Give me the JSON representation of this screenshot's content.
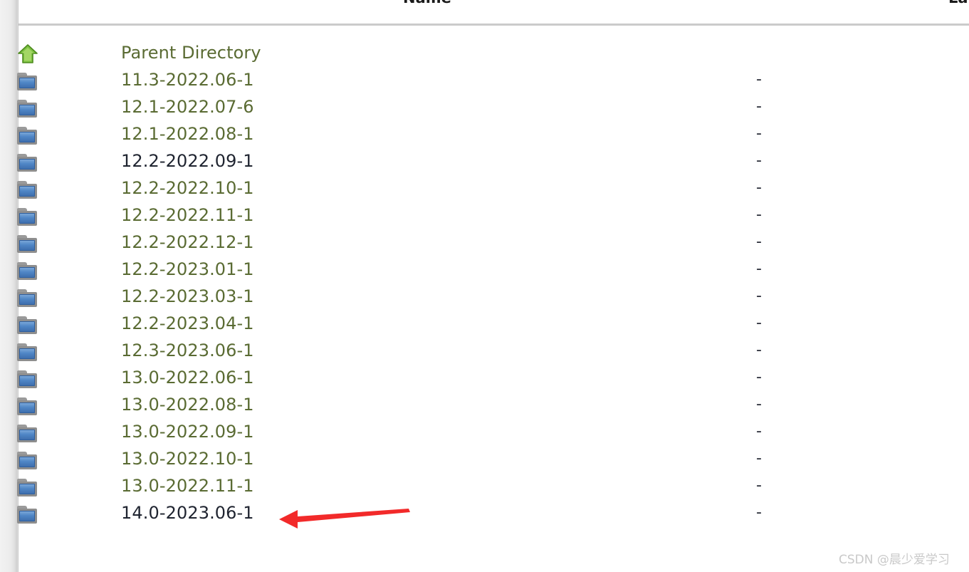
{
  "page": {
    "background_color": "#ffffff",
    "visited_link_color": "#5a6b33",
    "unvisited_link_color": "#1f2430",
    "rule_color": "#cbcbcb",
    "annotation_arrow_color": "#f22a2a"
  },
  "headers": {
    "name": "Name",
    "last_modified": "La"
  },
  "listing": {
    "rows": [
      {
        "icon": "up-arrow-icon",
        "name": "Parent Directory",
        "size": "",
        "visited": true
      },
      {
        "icon": "folder-icon",
        "name": "11.3-2022.06-1",
        "size": "-",
        "visited": true
      },
      {
        "icon": "folder-icon",
        "name": "12.1-2022.07-6",
        "size": "-",
        "visited": true
      },
      {
        "icon": "folder-icon",
        "name": "12.1-2022.08-1",
        "size": "-",
        "visited": true
      },
      {
        "icon": "folder-icon",
        "name": "12.2-2022.09-1",
        "size": "-",
        "visited": false
      },
      {
        "icon": "folder-icon",
        "name": "12.2-2022.10-1",
        "size": "-",
        "visited": true
      },
      {
        "icon": "folder-icon",
        "name": "12.2-2022.11-1",
        "size": "-",
        "visited": true
      },
      {
        "icon": "folder-icon",
        "name": "12.2-2022.12-1",
        "size": "-",
        "visited": true
      },
      {
        "icon": "folder-icon",
        "name": "12.2-2023.01-1",
        "size": "-",
        "visited": true
      },
      {
        "icon": "folder-icon",
        "name": "12.2-2023.03-1",
        "size": "-",
        "visited": true
      },
      {
        "icon": "folder-icon",
        "name": "12.2-2023.04-1",
        "size": "-",
        "visited": true
      },
      {
        "icon": "folder-icon",
        "name": "12.3-2023.06-1",
        "size": "-",
        "visited": true
      },
      {
        "icon": "folder-icon",
        "name": "13.0-2022.06-1",
        "size": "-",
        "visited": true
      },
      {
        "icon": "folder-icon",
        "name": "13.0-2022.08-1",
        "size": "-",
        "visited": true
      },
      {
        "icon": "folder-icon",
        "name": "13.0-2022.09-1",
        "size": "-",
        "visited": true
      },
      {
        "icon": "folder-icon",
        "name": "13.0-2022.10-1",
        "size": "-",
        "visited": true
      },
      {
        "icon": "folder-icon",
        "name": "13.0-2022.11-1",
        "size": "-",
        "visited": true
      },
      {
        "icon": "folder-icon",
        "name": "14.0-2023.06-1",
        "size": "-",
        "visited": false
      }
    ]
  },
  "annotation": {
    "target_row_name": "14.0-2023.06-1"
  },
  "watermark": {
    "text": "CSDN @晨少爱学习"
  }
}
